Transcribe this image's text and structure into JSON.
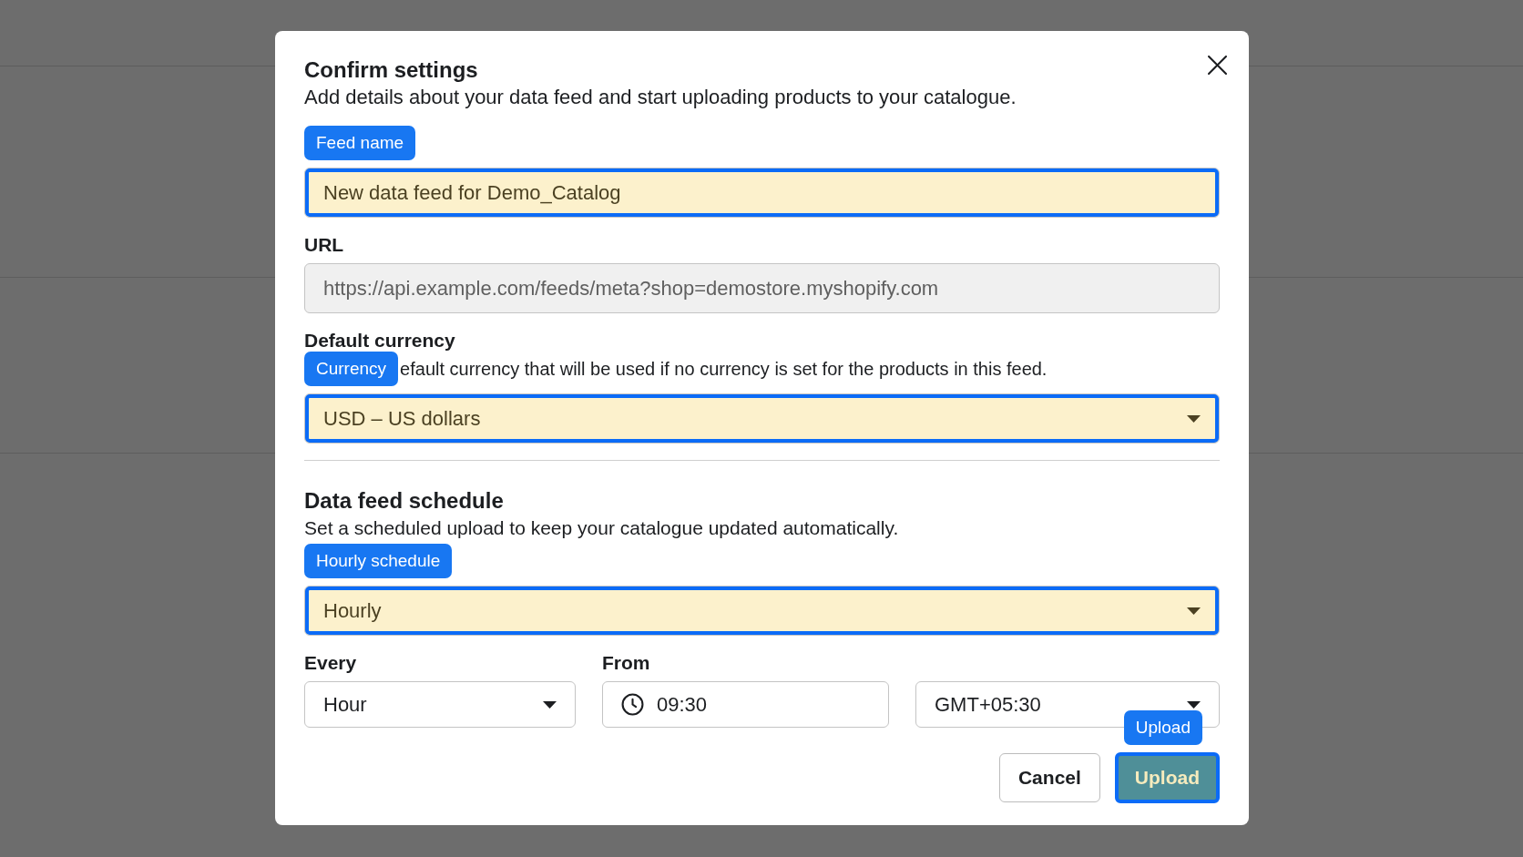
{
  "dialog": {
    "title": "Confirm settings",
    "subtitle": "Add details about your data feed and start uploading products to your catalogue."
  },
  "fields": [
    {
      "kind": "text",
      "tag": "Feed name",
      "value": "New data feed for Demo_Catalog",
      "highlighted": true,
      "disabled": false
    },
    {
      "kind": "text",
      "label": "URL",
      "value": "https://api.example.com/feeds/meta?shop=demostore.myshopify.com",
      "highlighted": false,
      "disabled": true
    },
    {
      "kind": "select",
      "label": "Default currency",
      "tag": "Currency",
      "description": "efault currency that will be used if no currency is set for the products in this feed.",
      "value": "USD – US dollars",
      "highlighted": true,
      "disabled": false
    }
  ],
  "schedule": {
    "title": "Data feed schedule",
    "description": "Set a scheduled upload to keep your catalogue updated automatically.",
    "fields": [
      {
        "kind": "select",
        "tag": "Hourly schedule",
        "value": "Hourly",
        "highlighted": true,
        "disabled": false
      }
    ],
    "row": [
      {
        "kind": "select",
        "label": "Every",
        "value": "Hour",
        "highlighted": false,
        "disabled": false
      },
      {
        "kind": "time",
        "label": "From",
        "value": "09:30",
        "highlighted": false,
        "disabled": false
      },
      {
        "kind": "select",
        "value": "GMT+05:30",
        "highlighted": false,
        "disabled": false
      }
    ]
  },
  "buttons": [
    {
      "kind": "secondary",
      "label": "Cancel",
      "highlighted": false
    },
    {
      "kind": "primary",
      "label": "Upload",
      "tag": "Upload",
      "highlighted": true
    }
  ]
}
